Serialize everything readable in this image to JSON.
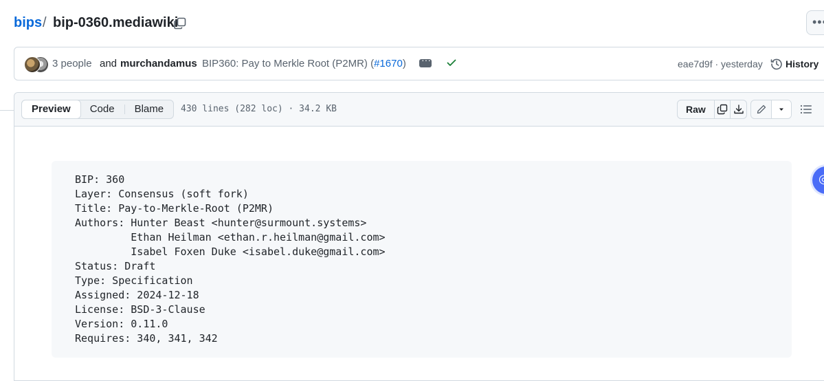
{
  "breadcrumb": {
    "repo": "bips",
    "separator": "/",
    "file": "bip-0360.mediawiki"
  },
  "commit": {
    "people": "3 people",
    "and": "and",
    "author": "murchandamus",
    "message": "BIP360: Pay to Merkle Root (P2MR) (",
    "pr_link": "#1670",
    "message_end": ")",
    "sha_time": "eae7d9f · yesterday",
    "history_label": "History",
    "status_color": "#1a7f37"
  },
  "file_header": {
    "tabs": [
      "Preview",
      "Code",
      "Blame"
    ],
    "active_tab": "Preview",
    "meta": "430 lines (282 loc) · 34.2 KB",
    "raw_label": "Raw"
  },
  "content": {
    "lines": [
      "BIP: 360",
      "Layer: Consensus (soft fork)",
      "Title: Pay-to-Merkle-Root (P2MR)",
      "Authors: Hunter Beast <hunter@surmount.systems>",
      "         Ethan Heilman <ethan.r.heilman@gmail.com>",
      "         Isabel Foxen Duke <isabel.duke@gmail.com>",
      "Status: Draft",
      "Type: Specification",
      "Assigned: 2024-12-18",
      "License: BSD-3-Clause",
      "Version: 0.11.0",
      "Requires: 340, 341, 342"
    ]
  },
  "icons": {
    "copy_path": "copy-icon",
    "more": "kebab-horizontal-icon",
    "check": "check-icon",
    "history": "history-icon",
    "copy_content": "copy-icon",
    "download": "download-icon",
    "edit": "pencil-icon",
    "dropdown": "triangle-down-icon",
    "outline": "list-unordered-icon"
  },
  "colors": {
    "link": "#0969da",
    "muted": "#59636e",
    "border": "#d1d9e0",
    "header_bg": "#f6f8fa"
  }
}
